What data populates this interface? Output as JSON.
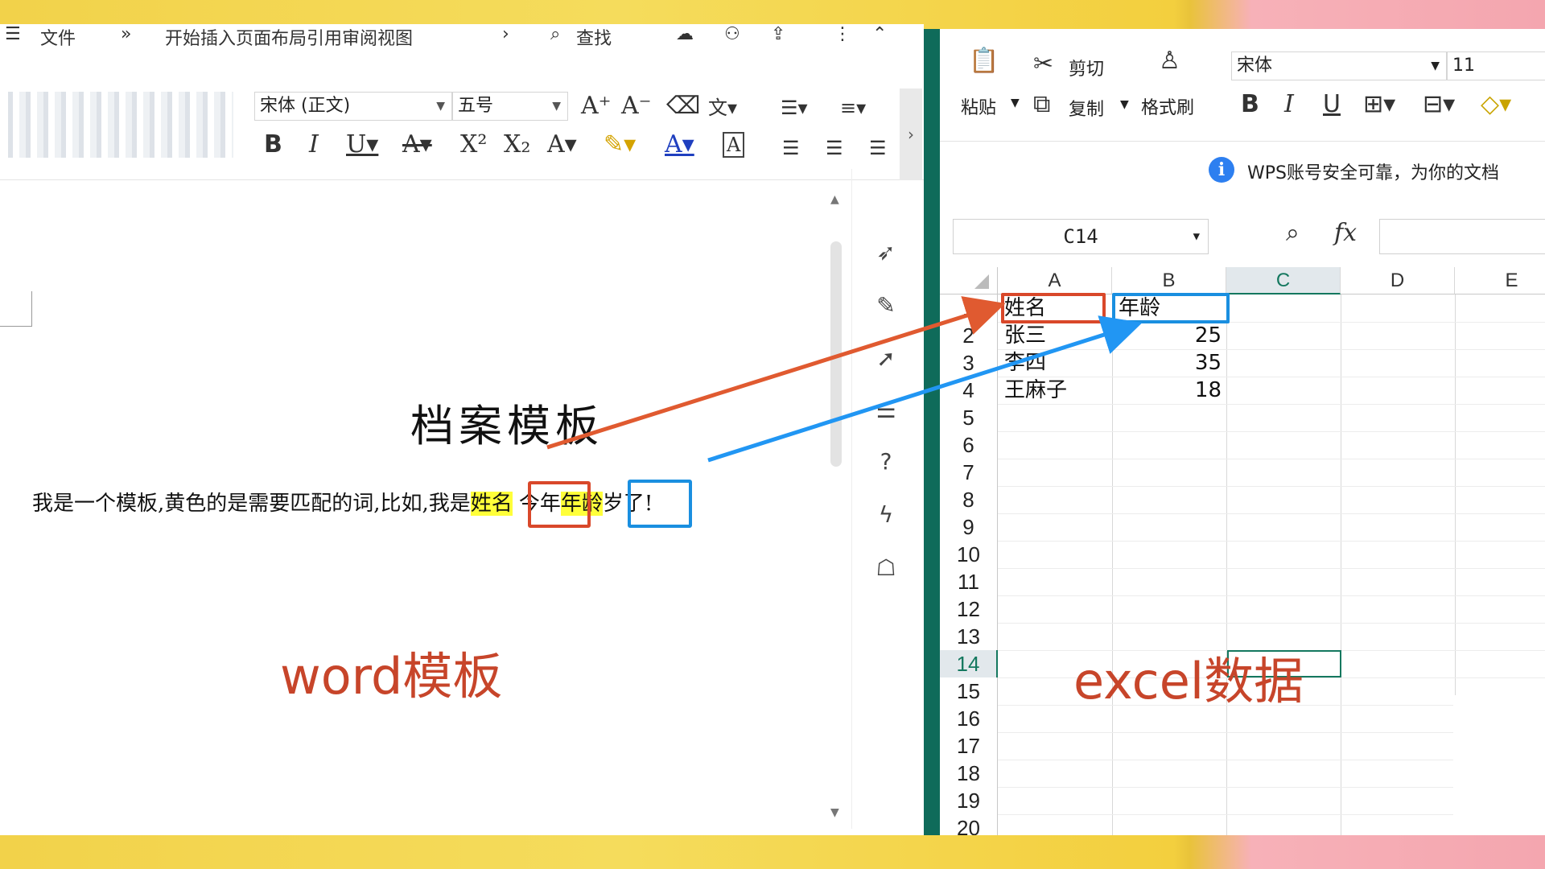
{
  "word": {
    "menu": [
      "文件",
      "»",
      "开始插入页面布局引用审阅视图",
      "›",
      "查找"
    ],
    "font_name": "宋体 (正文)",
    "font_size": "五号",
    "doc_title": "档案模板",
    "body": {
      "before": "我是一个模板,黄色的是需要匹配的词,比如,我是",
      "field1": "姓名",
      "middle": "今年",
      "field2": "年龄",
      "after": "岁了!"
    },
    "label": "word模板"
  },
  "excel": {
    "ribbon": {
      "paste": "粘贴",
      "cut": "剪切",
      "copy": "复制",
      "format_painter": "格式刷",
      "font_name": "宋体",
      "font_size": "11"
    },
    "notice": "WPS账号安全可靠，为你的文档",
    "namebox": "C14",
    "fx": "fx",
    "columns": [
      "A",
      "B",
      "C",
      "D",
      "E"
    ],
    "active_column": "C",
    "rows": [
      "1",
      "2",
      "3",
      "4",
      "5",
      "6",
      "7",
      "8",
      "9",
      "10",
      "11",
      "12",
      "13",
      "14",
      "15",
      "16",
      "17",
      "18",
      "19",
      "20"
    ],
    "active_row": "14",
    "cells": {
      "A1": "姓名",
      "B1": "年龄",
      "A2": "张三",
      "B2": "25",
      "A3": "李四",
      "B3": "35",
      "A4": "王麻子",
      "B4": "18"
    },
    "label": "excel数据"
  },
  "colors": {
    "red_marker": "#d9482a",
    "blue_marker": "#1a8fe0",
    "highlight": "#ffff3a",
    "excel_accent": "#14785f"
  }
}
